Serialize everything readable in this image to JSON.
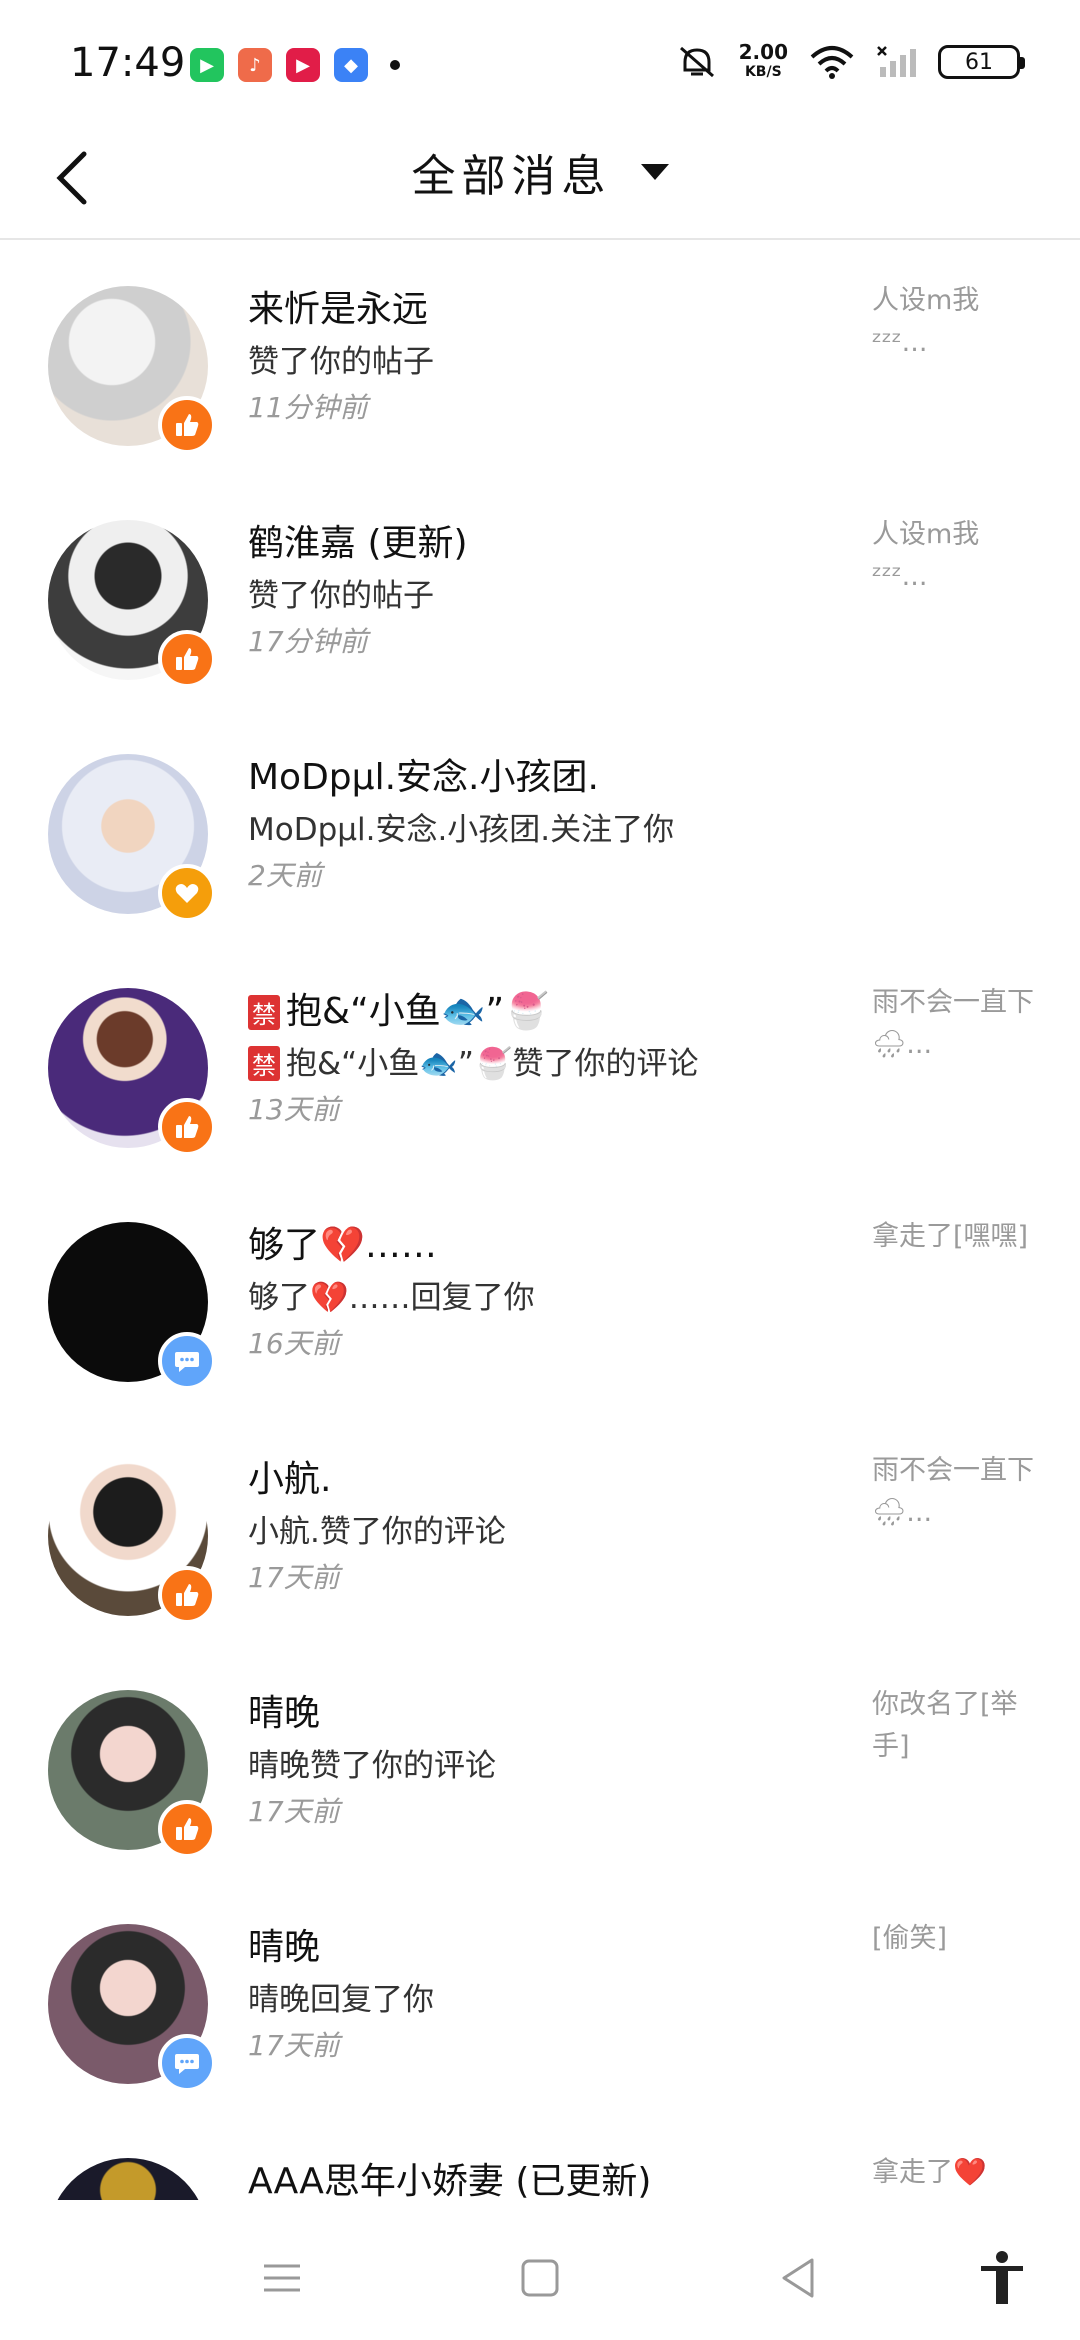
{
  "status_bar": {
    "time": "17:49",
    "speed_value": "2.00",
    "speed_unit": "KB/S",
    "battery": "61"
  },
  "header": {
    "title": "全部消息"
  },
  "messages": [
    {
      "name": "来忻是永远",
      "action": "赞了你的帖子",
      "time": "11分钟前",
      "preview": "人设m我 ᶻᶻᶻ...",
      "badge": "like"
    },
    {
      "name": "鹤淮嘉 (更新)",
      "action": "赞了你的帖子",
      "time": "17分钟前",
      "preview": "人设m我 ᶻᶻᶻ...",
      "badge": "like"
    },
    {
      "name": "MoDpµl.安念.小孩团.",
      "action": "MoDpµl.安念.小孩团.关注了你",
      "time": "2天前",
      "preview": "",
      "badge": "heart"
    },
    {
      "name": "抱&“小鱼🐟”🍧",
      "action": "抱&“小鱼🐟”🍧赞了你的评论",
      "time": "13天前",
      "preview": "雨不会一直下🌧...",
      "badge": "like",
      "tag": "禁"
    },
    {
      "name": "够了💔……",
      "action": "够了💔……回复了你",
      "time": "16天前",
      "preview": "拿走了[嘿嘿]",
      "badge": "comment"
    },
    {
      "name": "小航.",
      "action": "小航.赞了你的评论",
      "time": "17天前",
      "preview": "雨不会一直下🌧...",
      "badge": "like"
    },
    {
      "name": "晴晚",
      "action": "晴晚赞了你的评论",
      "time": "17天前",
      "preview": "你改名了[举手]",
      "badge": "like"
    },
    {
      "name": "晴晚",
      "action": "晴晚回复了你",
      "time": "17天前",
      "preview": "[偷笑]",
      "badge": "comment"
    },
    {
      "name": "AAA思年小娇妻 (已更新)",
      "action": "",
      "time": "",
      "preview": "拿走了❤️",
      "badge": ""
    }
  ],
  "colors": {
    "like_badge": "#f97316",
    "comment_badge": "#60a5fa",
    "heart_badge": "#f59e0b"
  },
  "icons": {
    "back": "chevron-left-icon",
    "dropdown": "caret-down-icon",
    "like": "thumbs-up-icon",
    "heart": "heart-icon",
    "comment": "chat-bubble-icon",
    "nav_menu": "menu-icon",
    "nav_home": "square-icon",
    "nav_back": "triangle-back-icon",
    "accessibility": "accessibility-icon"
  }
}
